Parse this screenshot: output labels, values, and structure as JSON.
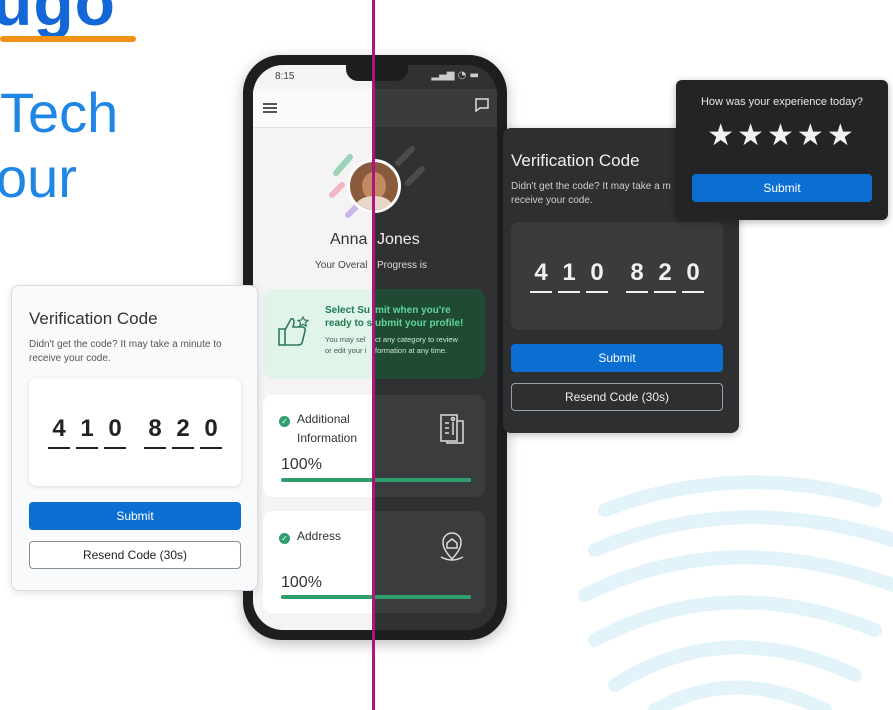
{
  "hero": {
    "word_fragment": "ugo",
    "line1": "Tech",
    "line2": "our"
  },
  "colors": {
    "primary_blue": "#0b6fd1",
    "accent_orange": "#f29118",
    "divider_magenta": "#b3127d",
    "progress_green": "#2e9e6b"
  },
  "verification_light": {
    "title": "Verification Code",
    "subtitle_line1": "Didn't get the code? It may take a minute to",
    "subtitle_line2": "receive your code.",
    "code_left": [
      "4",
      "1",
      "0"
    ],
    "code_right": [
      "8",
      "2",
      "0"
    ],
    "submit_label": "Submit",
    "resend_label": "Resend Code (30s)"
  },
  "verification_dark": {
    "title": "Verification Code",
    "subtitle_line1": "Didn't get the code? It may take a m",
    "subtitle_line2": "receive your code.",
    "code_left": [
      "4",
      "1",
      "0"
    ],
    "code_right": [
      "8",
      "2",
      "0"
    ],
    "submit_label": "Submit",
    "resend_label": "Resend Code (30s)"
  },
  "rating": {
    "question": "How was your experience today?",
    "stars": "★★★★★",
    "star_count": 5,
    "submit_label": "Submit"
  },
  "phone": {
    "status_time": "8:15",
    "status_icons": "▂▄▆ ◔ ▬",
    "profile_first": "Anna",
    "profile_last": "Jones",
    "progress_label_left": "Your Overal",
    "progress_label_right": "Progress is",
    "banner_heading_left1": "Select Su",
    "banner_heading_right1": "mit when you're",
    "banner_heading_left2": "ready to s",
    "banner_heading_right2": "ubmit your profile!",
    "banner_body_left1": "You may sel",
    "banner_body_right1": "ct any category to review",
    "banner_body_left2": "or edit your i",
    "banner_body_right2": "formation at any time.",
    "cards": [
      {
        "label_line1": "Additional",
        "label_line2": "Information",
        "percent_text": "100%",
        "progress": 1.0
      },
      {
        "label_line1": "Address",
        "label_line2": "",
        "percent_text": "100%",
        "progress": 1.0
      }
    ]
  }
}
